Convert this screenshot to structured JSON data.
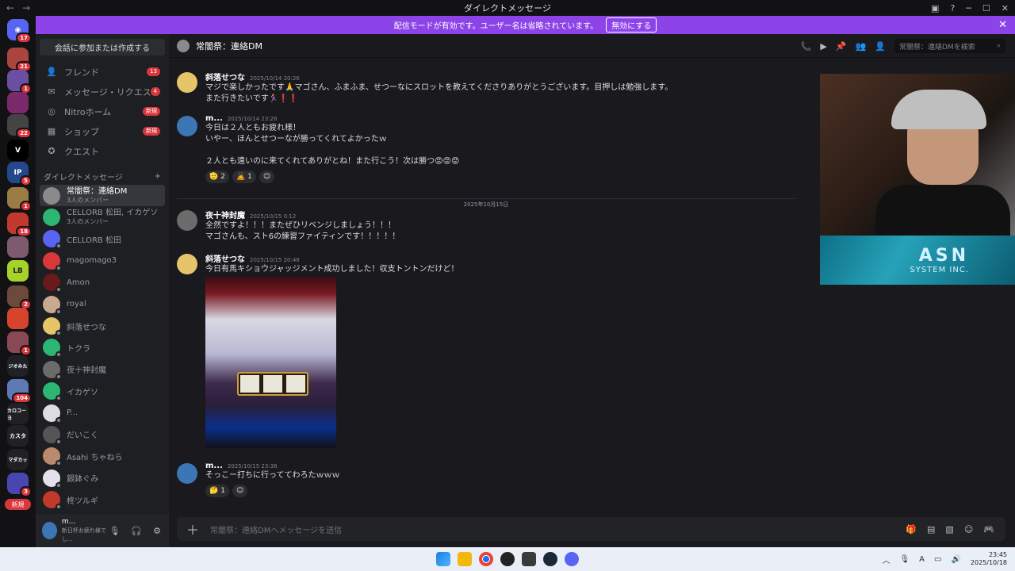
{
  "window": {
    "title": "ダイレクトメッセージ",
    "back": "←",
    "forward": "→"
  },
  "banner": {
    "text": "配信モードが有効です。ユーザー名は省略されています。",
    "button": "無効にする",
    "close": "✕"
  },
  "server_rail": {
    "badges": [
      "17",
      "21",
      "1",
      "22",
      "5",
      "1",
      "18",
      "2",
      "1",
      "104",
      "3"
    ],
    "labels": [
      "V",
      "IP",
      "ジオみた",
      "カロコーヨ",
      "カスタ",
      "マダカッ",
      "新規"
    ]
  },
  "sidebar": {
    "join_button": "会話に参加または作成する",
    "nav": [
      {
        "label": "フレンド",
        "badge": "13"
      },
      {
        "label": "メッセージ・リクエス...",
        "badge": "4"
      },
      {
        "label": "Nitroホーム",
        "badge": "新規"
      },
      {
        "label": "ショップ",
        "badge": "新規"
      },
      {
        "label": "クエスト",
        "badge": ""
      }
    ],
    "dm_header": "ダイレクトメッセージ",
    "dm_add": "+",
    "dms": [
      {
        "name": "常闇祭：連絡DM",
        "sub": "3人のメンバー"
      },
      {
        "name": "CELLORB 松田, イカゲソ",
        "sub": "3人のメンバー"
      },
      {
        "name": "CELLORB 松田",
        "sub": ""
      },
      {
        "name": "magomago3",
        "sub": ""
      },
      {
        "name": "Amon",
        "sub": ""
      },
      {
        "name": "royal",
        "sub": ""
      },
      {
        "name": "斜落せつな",
        "sub": ""
      },
      {
        "name": "トクラ",
        "sub": ""
      },
      {
        "name": "夜十神封魔",
        "sub": ""
      },
      {
        "name": "イカゲソ",
        "sub": ""
      },
      {
        "name": "P...",
        "sub": ""
      },
      {
        "name": "だいこく",
        "sub": ""
      },
      {
        "name": "Asahi ちゃねら",
        "sub": ""
      },
      {
        "name": "銀鉢ぐみ",
        "sub": ""
      },
      {
        "name": "柊ツルギ",
        "sub": ""
      }
    ],
    "user": {
      "name": "m...",
      "status": "新日杯お疲れ様でし..."
    }
  },
  "chat": {
    "title": "常闇祭：連絡DM",
    "search_placeholder": "常闇祭：連絡DMを検索",
    "date_divider": "2025年10月15日",
    "messages": [
      {
        "author": "斜落せつな",
        "time": "2025/10/14 20:26",
        "lines": [
          "マジで楽しかったです🙏マゴさん、ふまふま、せつーなにスロットを教えてくださりありがとうございます。目押しは勉強します。",
          "また行きたいです🏃‍♀️❗❗"
        ]
      },
      {
        "author": "m...",
        "time": "2025/10/14 23:26",
        "lines": [
          "今日は２人ともお疲れ様！",
          "いやー、ほんとせつーなが勝ってくれてよかったｗ",
          "",
          "２人とも遠いのに来てくれてありがとね！また行こう！次は勝つ😡😡😡"
        ],
        "reactions": [
          {
            "emoji": "🫡",
            "count": "2"
          },
          {
            "emoji": "🙇",
            "count": "1"
          },
          {
            "emoji": "☺",
            "count": ""
          }
        ]
      },
      {
        "author": "夜十神封魔",
        "time": "2025/10/15 0:12",
        "lines": [
          "全然ですよ！！！またぜひリベンジしましょう！！！",
          "マゴさんも、スト6の練習ファイティンです！！！！！"
        ]
      },
      {
        "author": "斜落せつな",
        "time": "2025/10/15 20:48",
        "lines": [
          "今日有馬キショウジャッジメント成功しました！収支トントンだけど！"
        ]
      },
      {
        "author": "m...",
        "time": "2025/10/15 23:36",
        "lines": [
          "そっこー打ちに行っててわろたｗｗｗ"
        ],
        "reactions": [
          {
            "emoji": "🤔",
            "count": "1"
          },
          {
            "emoji": "☺",
            "count": ""
          }
        ]
      }
    ],
    "composer_placeholder": "常闇祭：連絡DMへメッセージを送信"
  },
  "overlay": {
    "logo_main": "ASN",
    "logo_sub": "SYSTEM INC."
  },
  "taskbar": {
    "time": "23:45",
    "date": "2025/10/18",
    "ime": "A"
  },
  "colors": {
    "banner": "#8c44e8",
    "badge": "#da373c",
    "bg": "#1a1a1e"
  }
}
